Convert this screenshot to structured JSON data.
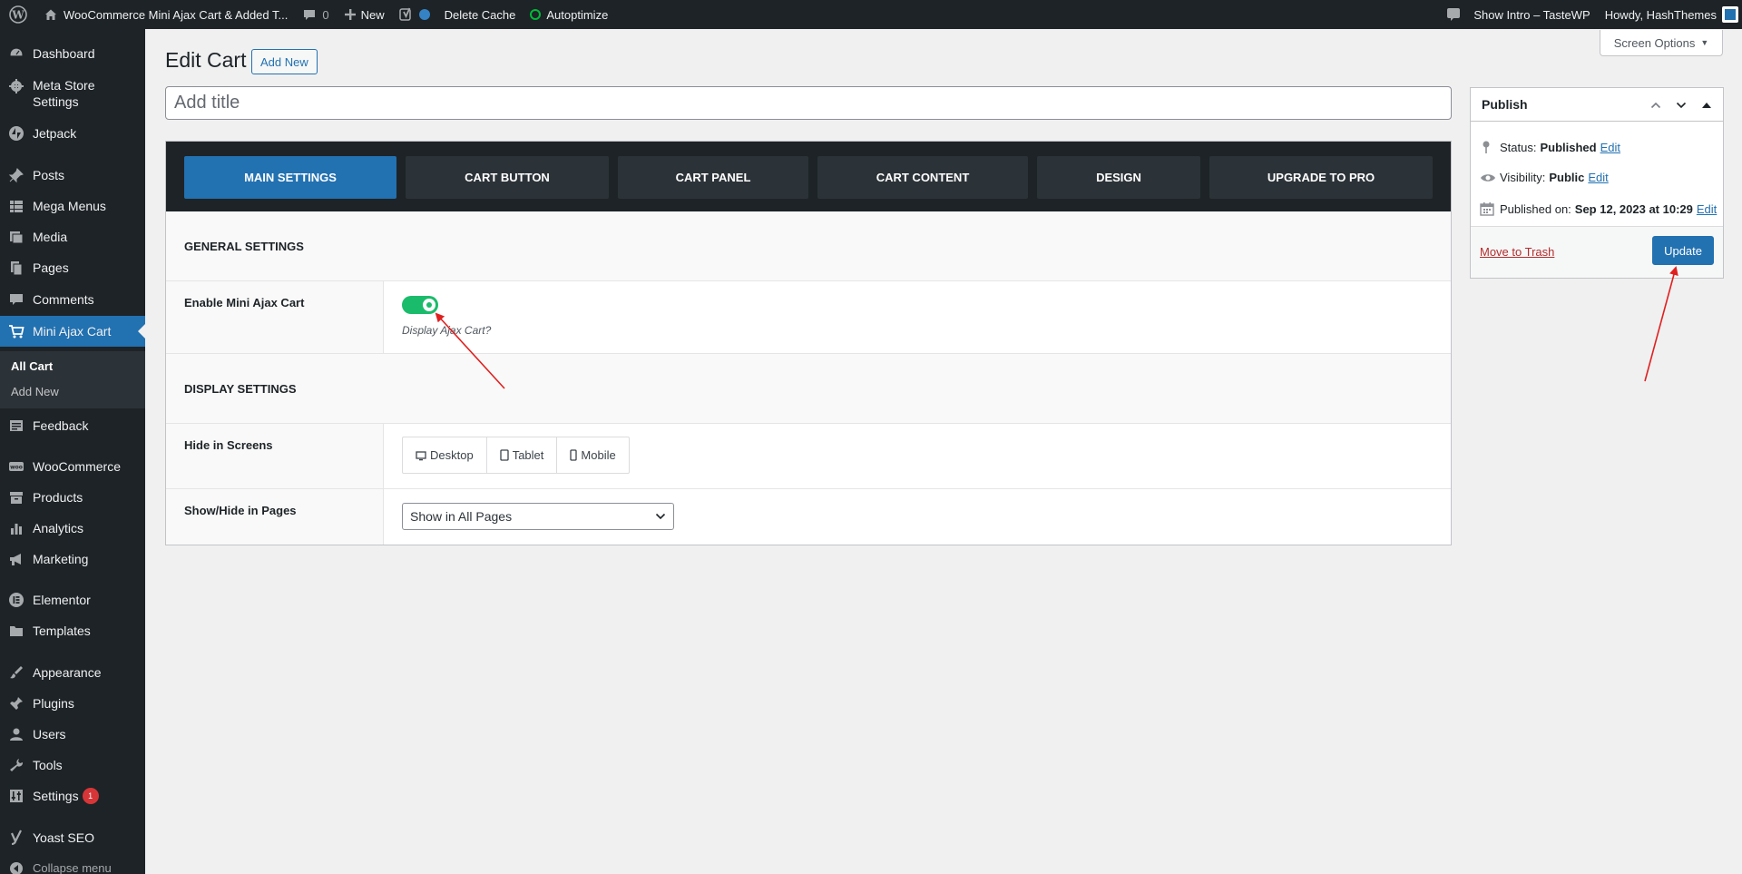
{
  "adminbar": {
    "site_name": "WooCommerce Mini Ajax Cart & Added T...",
    "comments_count": "0",
    "new_label": "New",
    "delete_cache_label": "Delete Cache",
    "autoptimize_label": "Autoptimize",
    "show_intro_label": "Show Intro – TasteWP",
    "howdy_label": "Howdy, HashThemes"
  },
  "sidebar": {
    "items": [
      {
        "label": "Dashboard",
        "icon": "dashboard-icon"
      },
      {
        "label": "Meta Store Settings",
        "icon": "gear-icon"
      },
      {
        "label": "Jetpack",
        "icon": "jetpack-icon"
      },
      {
        "label": "Posts",
        "icon": "pin-icon"
      },
      {
        "label": "Mega Menus",
        "icon": "grid-icon"
      },
      {
        "label": "Media",
        "icon": "media-icon"
      },
      {
        "label": "Pages",
        "icon": "pages-icon"
      },
      {
        "label": "Comments",
        "icon": "comment-icon"
      },
      {
        "label": "Mini Ajax Cart",
        "icon": "cart-icon"
      },
      {
        "label": "Feedback",
        "icon": "feedback-icon"
      },
      {
        "label": "WooCommerce",
        "icon": "woo-icon"
      },
      {
        "label": "Products",
        "icon": "archive-icon"
      },
      {
        "label": "Analytics",
        "icon": "bar-chart-icon"
      },
      {
        "label": "Marketing",
        "icon": "megaphone-icon"
      },
      {
        "label": "Elementor",
        "icon": "elementor-icon"
      },
      {
        "label": "Templates",
        "icon": "folder-icon"
      },
      {
        "label": "Appearance",
        "icon": "brush-icon"
      },
      {
        "label": "Plugins",
        "icon": "plugin-icon"
      },
      {
        "label": "Users",
        "icon": "user-icon"
      },
      {
        "label": "Tools",
        "icon": "wrench-icon"
      },
      {
        "label": "Settings",
        "icon": "settings-icon"
      },
      {
        "label": "Yoast SEO",
        "icon": "yoast-icon"
      },
      {
        "label": "Collapse menu",
        "icon": "collapse-icon"
      }
    ],
    "settings_badge": "1",
    "submenu": [
      {
        "label": "All Cart"
      },
      {
        "label": "Add New"
      }
    ]
  },
  "main": {
    "page_title": "Edit Cart",
    "add_new_label": "Add New",
    "screen_options_label": "Screen Options",
    "title_placeholder": "Add title",
    "tabs": [
      {
        "label": "MAIN SETTINGS"
      },
      {
        "label": "CART BUTTON"
      },
      {
        "label": "CART PANEL"
      },
      {
        "label": "CART CONTENT"
      },
      {
        "label": "DESIGN"
      },
      {
        "label": "UPGRADE TO PRO"
      }
    ],
    "general_settings_title": "GENERAL SETTINGS",
    "enable_label": "Enable Mini Ajax Cart",
    "enable_desc": "Display Ajax Cart?",
    "enable_value": true,
    "display_settings_title": "DISPLAY SETTINGS",
    "hide_screens_label": "Hide in Screens",
    "devices": [
      {
        "label": "Desktop"
      },
      {
        "label": "Tablet"
      },
      {
        "label": "Mobile"
      }
    ],
    "show_hide_label": "Show/Hide in Pages",
    "show_hide_value": "Show in All Pages"
  },
  "publish": {
    "title": "Publish",
    "status_label": "Status:",
    "status_value": "Published",
    "visibility_label": "Visibility:",
    "visibility_value": "Public",
    "published_label": "Published on:",
    "published_value": "Sep 12, 2023 at 10:29",
    "edit_label": "Edit",
    "trash_label": "Move to Trash",
    "update_label": "Update"
  },
  "colors": {
    "accent": "#2271b1",
    "toggle_on": "#1abc6b",
    "admin_dark": "#1d2327",
    "annotation_arrow": "#e0201f"
  }
}
